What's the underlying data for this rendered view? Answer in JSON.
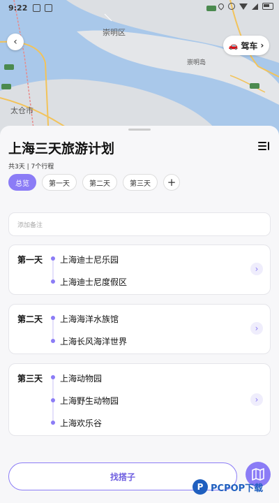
{
  "status_bar": {
    "time": "9:22"
  },
  "map": {
    "labels": [
      "崇明区",
      "崇明岛",
      "太仓市"
    ],
    "route_badges": [
      "G40",
      "G40",
      "G15",
      "G40"
    ],
    "drive_label": "驾车"
  },
  "plan": {
    "title": "上海三天旅游计划",
    "subtitle": "共3天 | 7个行程",
    "tabs": [
      "总览",
      "第一天",
      "第二天",
      "第三天"
    ],
    "note_placeholder": "添加备注",
    "days": [
      {
        "label": "第一天",
        "stops": [
          "上海迪士尼乐园",
          "上海迪士尼度假区"
        ]
      },
      {
        "label": "第二天",
        "stops": [
          "上海海洋水族馆",
          "上海长风海洋世界"
        ]
      },
      {
        "label": "第三天",
        "stops": [
          "上海动物园",
          "上海野生动物园",
          "上海欢乐谷"
        ]
      }
    ],
    "partner_button": "找搭子"
  },
  "watermark": {
    "text": "PCPOP下载"
  },
  "colors": {
    "accent": "#8b7cf6",
    "river": "#a9c8ea",
    "land": "#d9dde2",
    "road": "#f2c35a"
  }
}
